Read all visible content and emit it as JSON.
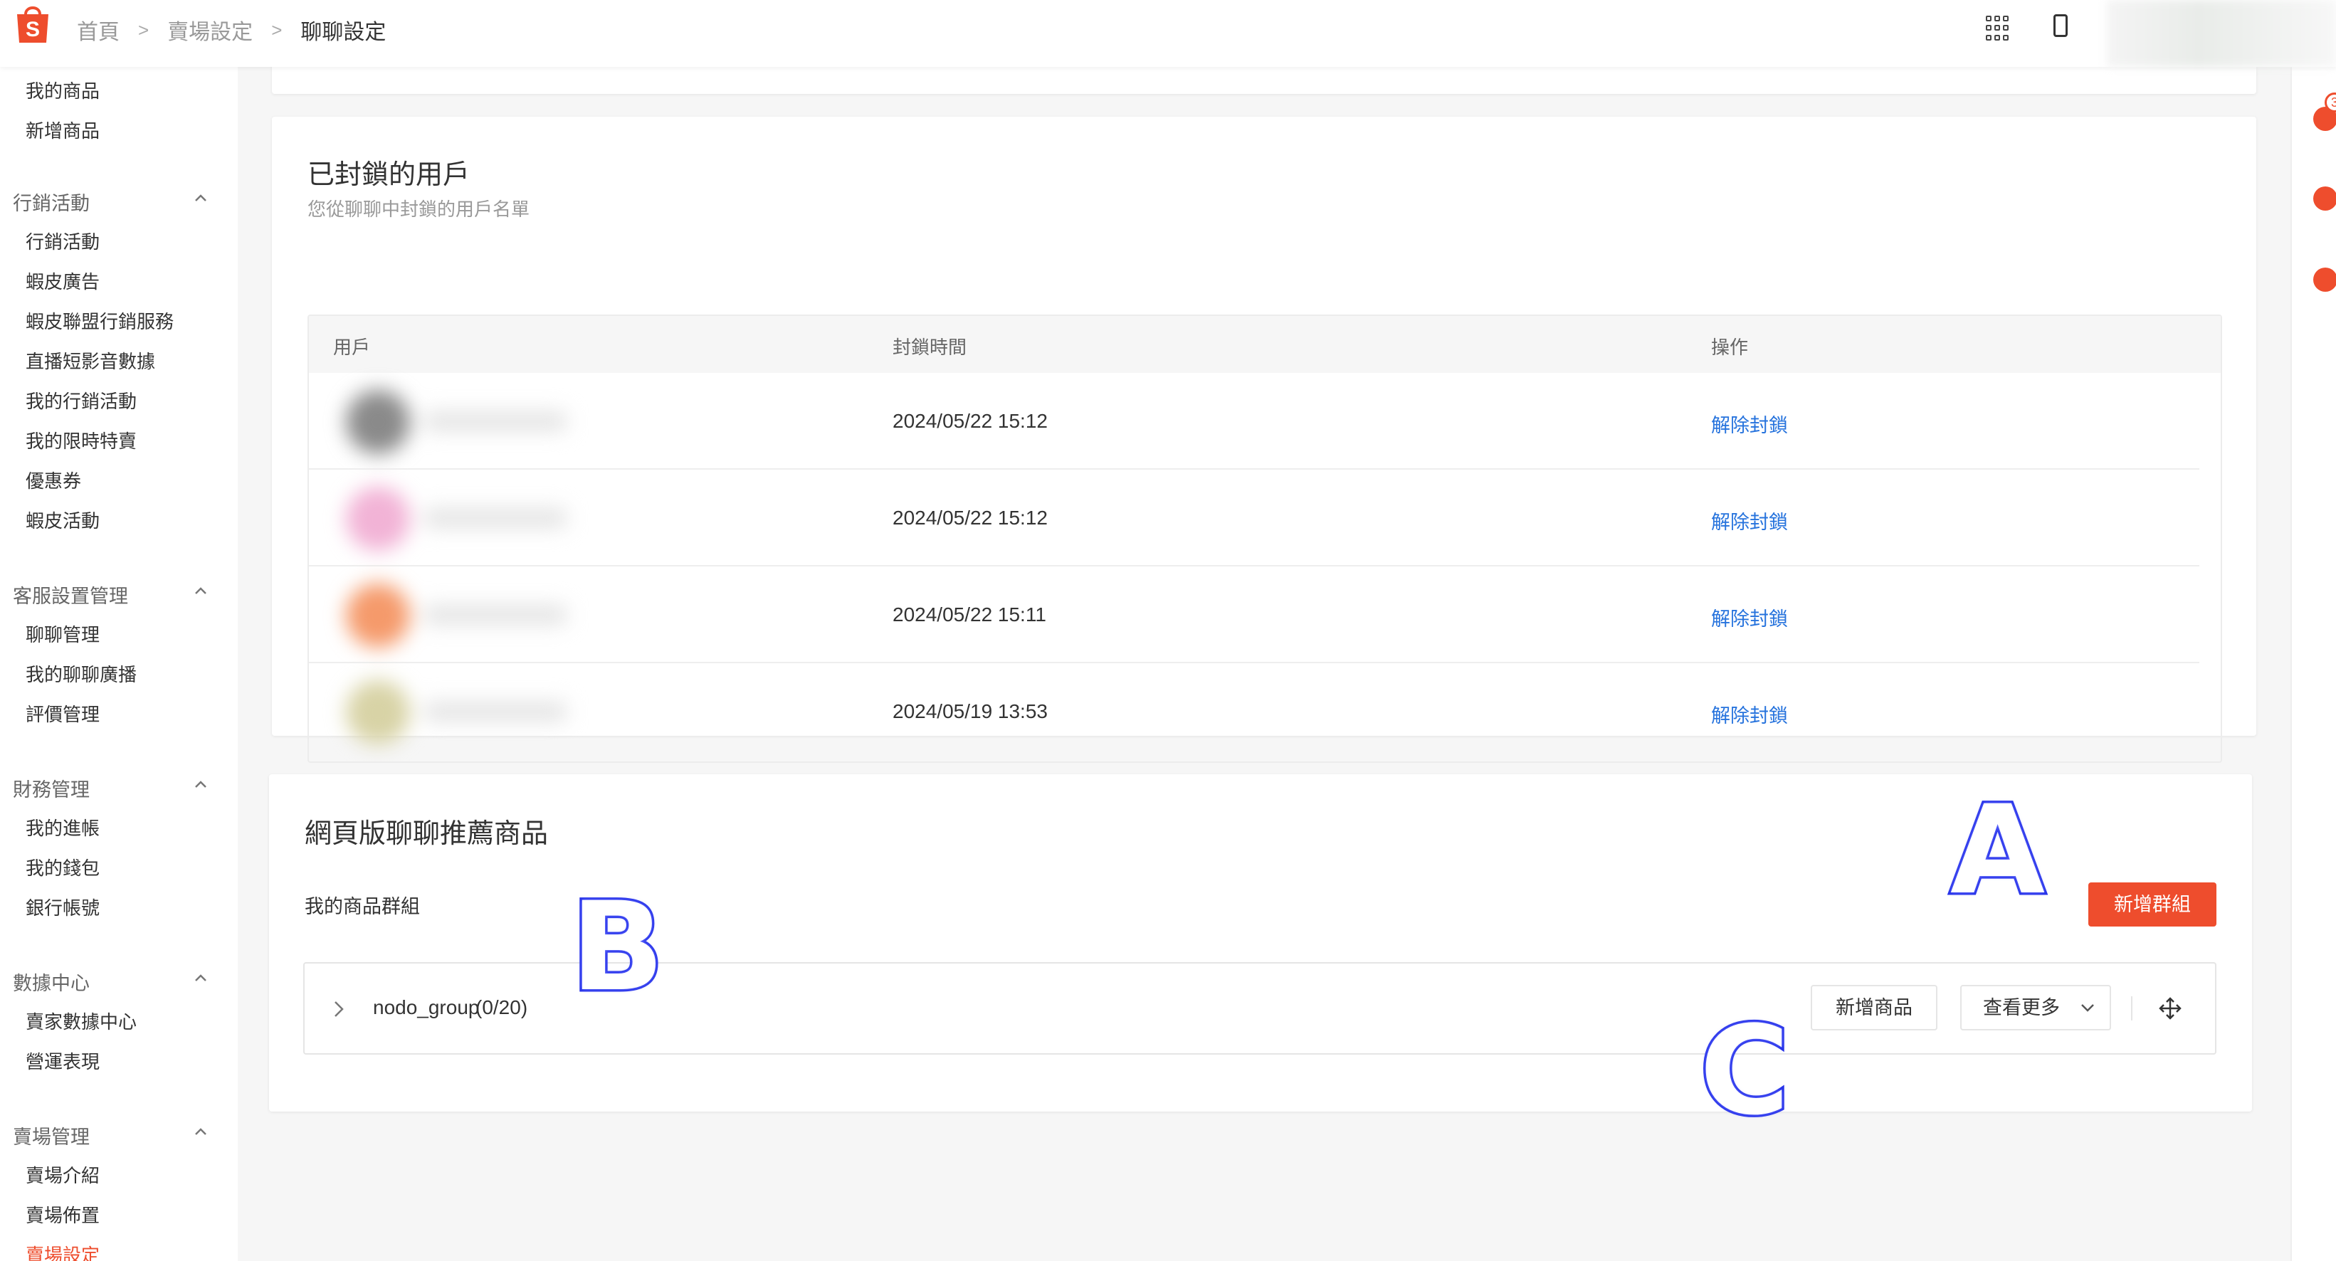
{
  "breadcrumb": [
    "首頁",
    "賣場設定",
    "聊聊設定"
  ],
  "colors": {
    "brand": "#ee4d2d",
    "link": "#2673dd",
    "annotation": "#2430e8"
  },
  "topbar_icons": [
    "apps-grid-icon",
    "mobile-icon"
  ],
  "sidebar": {
    "orphan_items": [
      "我的商品",
      "新增商品"
    ],
    "groups": [
      {
        "title": "行銷活動",
        "items": [
          "行銷活動",
          "蝦皮廣告",
          "蝦皮聯盟行銷服務",
          "直播短影音數據",
          "我的行銷活動",
          "我的限時特賣",
          "優惠券",
          "蝦皮活動"
        ]
      },
      {
        "title": "客服設置管理",
        "items": [
          "聊聊管理",
          "我的聊聊廣播",
          "評價管理"
        ]
      },
      {
        "title": "財務管理",
        "items": [
          "我的進帳",
          "我的錢包",
          "銀行帳號"
        ]
      },
      {
        "title": "數據中心",
        "items": [
          "賣家數據中心",
          "營運表現"
        ]
      },
      {
        "title": "賣場管理",
        "items": [
          "賣場介紹",
          "賣場佈置",
          "賣場設定"
        ]
      }
    ]
  },
  "right_rail": {
    "badge": "3",
    "icons": [
      "bell-icon",
      "headset-icon",
      "chat-icon"
    ]
  },
  "blocked_users": {
    "title": "已封鎖的用戶",
    "subtitle": "您從聊聊中封鎖的用戶名單",
    "columns": [
      "用戶",
      "封鎖時間",
      "操作"
    ],
    "rows": [
      {
        "time": "2024/05/22 15:12",
        "action": "解除封鎖",
        "avatar_color": "#8a8a8a"
      },
      {
        "time": "2024/05/22 15:12",
        "action": "解除封鎖",
        "avatar_color": "#f2b3d6"
      },
      {
        "time": "2024/05/22 15:11",
        "action": "解除封鎖",
        "avatar_color": "#f59a6b"
      },
      {
        "time": "2024/05/19 13:53",
        "action": "解除封鎖",
        "avatar_color": "#d8d3a6"
      }
    ]
  },
  "web_recommend": {
    "title": "網頁版聊聊推薦商品",
    "group_label": "我的商品群組",
    "add_group": "新增群組",
    "group_name": "nodo_group",
    "group_count": "(0/20)",
    "add_product": "新增商品",
    "view_more": "查看更多"
  },
  "annotations": [
    "A",
    "B",
    "C"
  ]
}
